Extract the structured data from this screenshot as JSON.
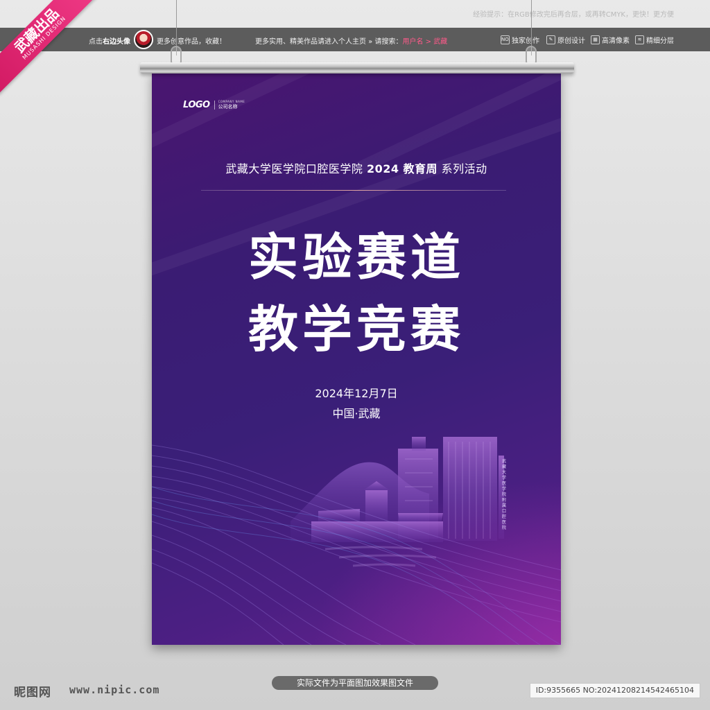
{
  "brand_ribbon": {
    "big": "武藏出品",
    "small": "MUSASHI DESIGN"
  },
  "tip": "经验提示：在RGB修改完后再合层，或再转CMYK，更快！更方便",
  "topbar": {
    "click_prefix": "点击",
    "click_bold": "右边头像",
    "more_works": "更多创意作品，收藏！",
    "more_practical": "更多实用、精美作品请进入个人主页 » 请搜索：",
    "username_hint": "用户名 > 武藏",
    "features": [
      {
        "icon": "NO.",
        "label": "独家创作"
      },
      {
        "icon": "✎",
        "label": "原创设计"
      },
      {
        "icon": "▦",
        "label": "高清像素"
      },
      {
        "icon": "≋",
        "label": "精细分层"
      }
    ]
  },
  "poster": {
    "logo_mark": "LOGO",
    "logo_en": "COMPANY NAME",
    "logo_cn": "公司名称",
    "subtitle_pre": "武藏大学医学院口腔医学院 ",
    "subtitle_bold": "2024 教育周",
    "subtitle_post": " 系列活动",
    "title_line1": "实验赛道",
    "title_line2": "教学竞赛",
    "date": "2024年12月7日",
    "place": "中国·武藏",
    "building_sign": "武藏大学医学院附属口腔医院"
  },
  "footer": {
    "site_logo": "昵图网",
    "site_url": "www.nipic.com",
    "note": "实际文件为平面图加效果图文件",
    "id_text": "ID:9355665 NO:20241208214542465104"
  },
  "colors": {
    "poster_top": "#4a1570",
    "poster_mid": "#3a1f78",
    "poster_bottom": "#6a2390",
    "ribbon": "#e0286f",
    "topbar": "#5c5c5c"
  }
}
